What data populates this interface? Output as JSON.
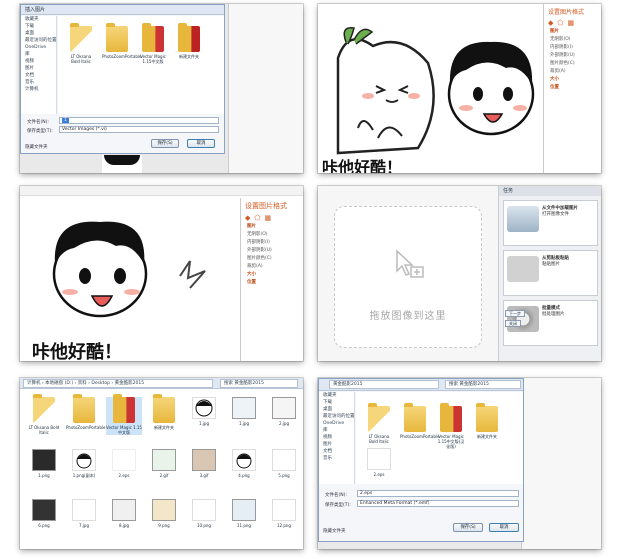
{
  "panel1": {
    "dialog_title": "插入图片",
    "nav": [
      "收藏夹",
      "下载",
      "桌面",
      "最近访问的位置",
      "OneDrive",
      "库",
      "视频",
      "图片",
      "文档",
      "音乐",
      "计算机"
    ],
    "files": [
      {
        "name": "LT Oksana Bold Italic"
      },
      {
        "name": "PhotoZoomPortable"
      },
      {
        "name": "Vector Magic 1.15中文版"
      },
      {
        "name": "新建文件夹"
      }
    ],
    "filename_label": "文件名(N):",
    "filename_value": "1",
    "filetype_label": "保存类型(T):",
    "filetype_value": "Vector Images (*.vi)",
    "tools_label": "工具(L)",
    "save_button": "保存(S)",
    "cancel_button": "取消",
    "hide_folders": "隐藏文件夹"
  },
  "panel2": {
    "caption": "咔他好酷！",
    "side_title": "设置图片格式",
    "side_items": [
      "图片",
      "无阴影(O)",
      "内部阴影(I)",
      "外部阴影(U)",
      "图片颜色(C)",
      "裁剪(A)",
      "大小",
      "位置"
    ]
  },
  "panel3": {
    "caption": "咔他好酷！",
    "side_title": "设置图片格式",
    "side_items": [
      "图片",
      "无阴影(O)",
      "内部阴影(I)",
      "外部阴影(U)",
      "图片颜色(C)",
      "裁剪(A)",
      "大小",
      "位置"
    ]
  },
  "panel4": {
    "drop_text": "拖放图像到这里",
    "task_title": "任务",
    "cards": [
      {
        "title": "从文件中加载图片",
        "sub": "打开图像文件"
      },
      {
        "title": "从剪贴板粘贴",
        "sub": "粘贴图片"
      },
      {
        "title": "批量模式",
        "sub": "批处理图片"
      }
    ],
    "button_next": "下一步",
    "button_close": "关闭"
  },
  "panel5": {
    "breadcrumb": "计算机 › 本地磁盘 (D:) › 资料 › Desktop › 黄金酷影2015",
    "search": "搜索 黄金酷影2015",
    "files_row1": [
      "LT Oksana Bold Italic",
      "PhotoZoomPortable",
      "Vector Magic 1.15中文版",
      "新建文件夹",
      "1.jpg",
      "1.jpg",
      "2.jpg"
    ],
    "files_row2": [
      "1.png",
      "1.png(副本)",
      "2.eps",
      "2.gif",
      "3.gif",
      "4.png",
      "5.png"
    ],
    "files_row3": [
      "6.png",
      "7.jpg",
      "8.jpg",
      "9.png",
      "10.png",
      "11.png",
      "12.png"
    ]
  },
  "panel6": {
    "breadcrumb": "黄金酷影2015",
    "search": "搜索 黄金酷影2015",
    "nav": [
      "收藏夹",
      "下载",
      "桌面",
      "最近访问的位置",
      "OneDrive",
      "库",
      "视频",
      "图片",
      "文档",
      "音乐"
    ],
    "files": [
      {
        "name": "LT Oksana Bold Italic"
      },
      {
        "name": "PhotoZoomPortable"
      },
      {
        "name": "Vector Magic 1.15中文版(汉化版)"
      },
      {
        "name": "新建文件夹"
      }
    ],
    "thumb_label": "2.eps",
    "filename_label": "文件名(N):",
    "filename_value": "2.eps",
    "filetype_label": "保存类型(T):",
    "filetype_value": "Enhanced Meta Format (*.emf)",
    "save_button": "保存(S)",
    "cancel_button": "取消",
    "hide_folders": "隐藏文件夹"
  }
}
